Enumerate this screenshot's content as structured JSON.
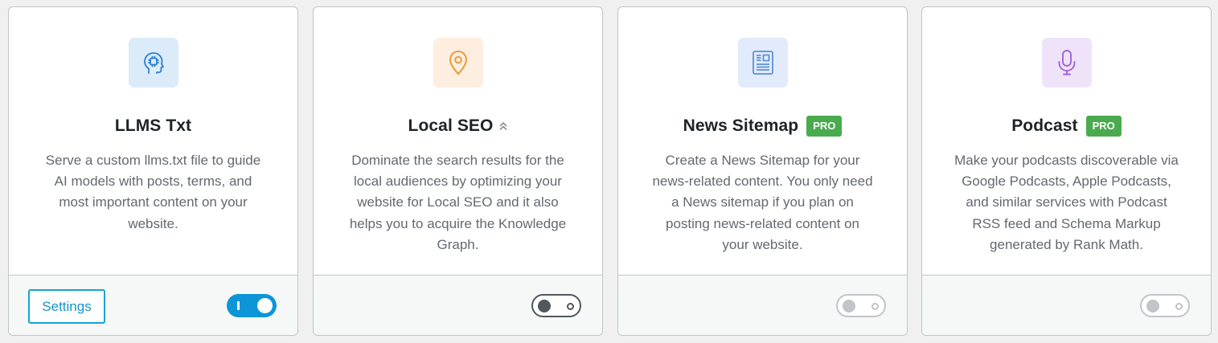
{
  "cards": [
    {
      "icon": "head-chip-icon",
      "icon_bg": "#dcebfa",
      "icon_color": "#2b7fd4",
      "title": "LLMS Txt",
      "pro": false,
      "description_lines": [
        "Serve a custom llms.txt file to guide",
        "AI models with posts, terms, and",
        "most important content on your",
        "website."
      ],
      "settings_label": "Settings",
      "toggle_state": "on"
    },
    {
      "icon": "map-pin-icon",
      "icon_bg": "#fdeee0",
      "icon_color": "#eb9a3c",
      "title": "Local SEO",
      "title_suffix": "⌃",
      "pro": false,
      "description_lines": [
        "Dominate the search results for the",
        "local audiences by optimizing your",
        "website for Local SEO and it also",
        "helps you to acquire the Knowledge",
        "Graph."
      ],
      "toggle_state": "off"
    },
    {
      "icon": "newspaper-icon",
      "icon_bg": "#e2ebfb",
      "icon_color": "#5b8fd8",
      "title": "News Sitemap",
      "pro": true,
      "pro_label": "PRO",
      "description_lines": [
        "Create a News Sitemap for your",
        "news-related content. You only need",
        "a News sitemap if you plan on",
        "posting news-related content on",
        "your website."
      ],
      "toggle_state": "disabled"
    },
    {
      "icon": "microphone-icon",
      "icon_bg": "#efe3fa",
      "icon_color": "#a262dc",
      "title": "Podcast",
      "pro": true,
      "pro_label": "PRO",
      "description_lines": [
        "Make your podcasts discoverable via",
        "Google Podcasts, Apple Podcasts,",
        "and similar services with Podcast",
        "RSS feed and Schema Markup",
        "generated by Rank Math."
      ],
      "toggle_state": "disabled"
    }
  ]
}
